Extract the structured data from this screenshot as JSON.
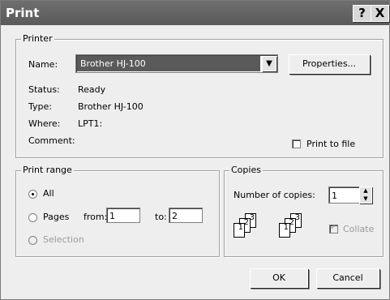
{
  "window": {
    "title": "Print"
  },
  "titlebar_buttons": {
    "help": "?",
    "close": "X"
  },
  "printer": {
    "group_label": "Printer",
    "name_label": "Name:",
    "name_value": "Brother HJ-100",
    "properties_button": "Properties...",
    "status_label": "Status:",
    "status_value": "Ready",
    "type_label": "Type:",
    "type_value": "Brother HJ-100",
    "where_label": "Where:",
    "where_value": "LPT1:",
    "comment_label": "Comment:",
    "print_to_file_label": "Print to file"
  },
  "print_range": {
    "group_label": "Print range",
    "all_label": "All",
    "pages_label": "Pages",
    "from_label": "from:",
    "from_value": "1",
    "to_label": "to:",
    "to_value": "2",
    "selection_label": "Selection"
  },
  "copies": {
    "group_label": "Copies",
    "number_label": "Number of copies:",
    "number_value": "1",
    "collate_label": "Collate"
  },
  "buttons": {
    "ok": "OK",
    "cancel": "Cancel"
  }
}
